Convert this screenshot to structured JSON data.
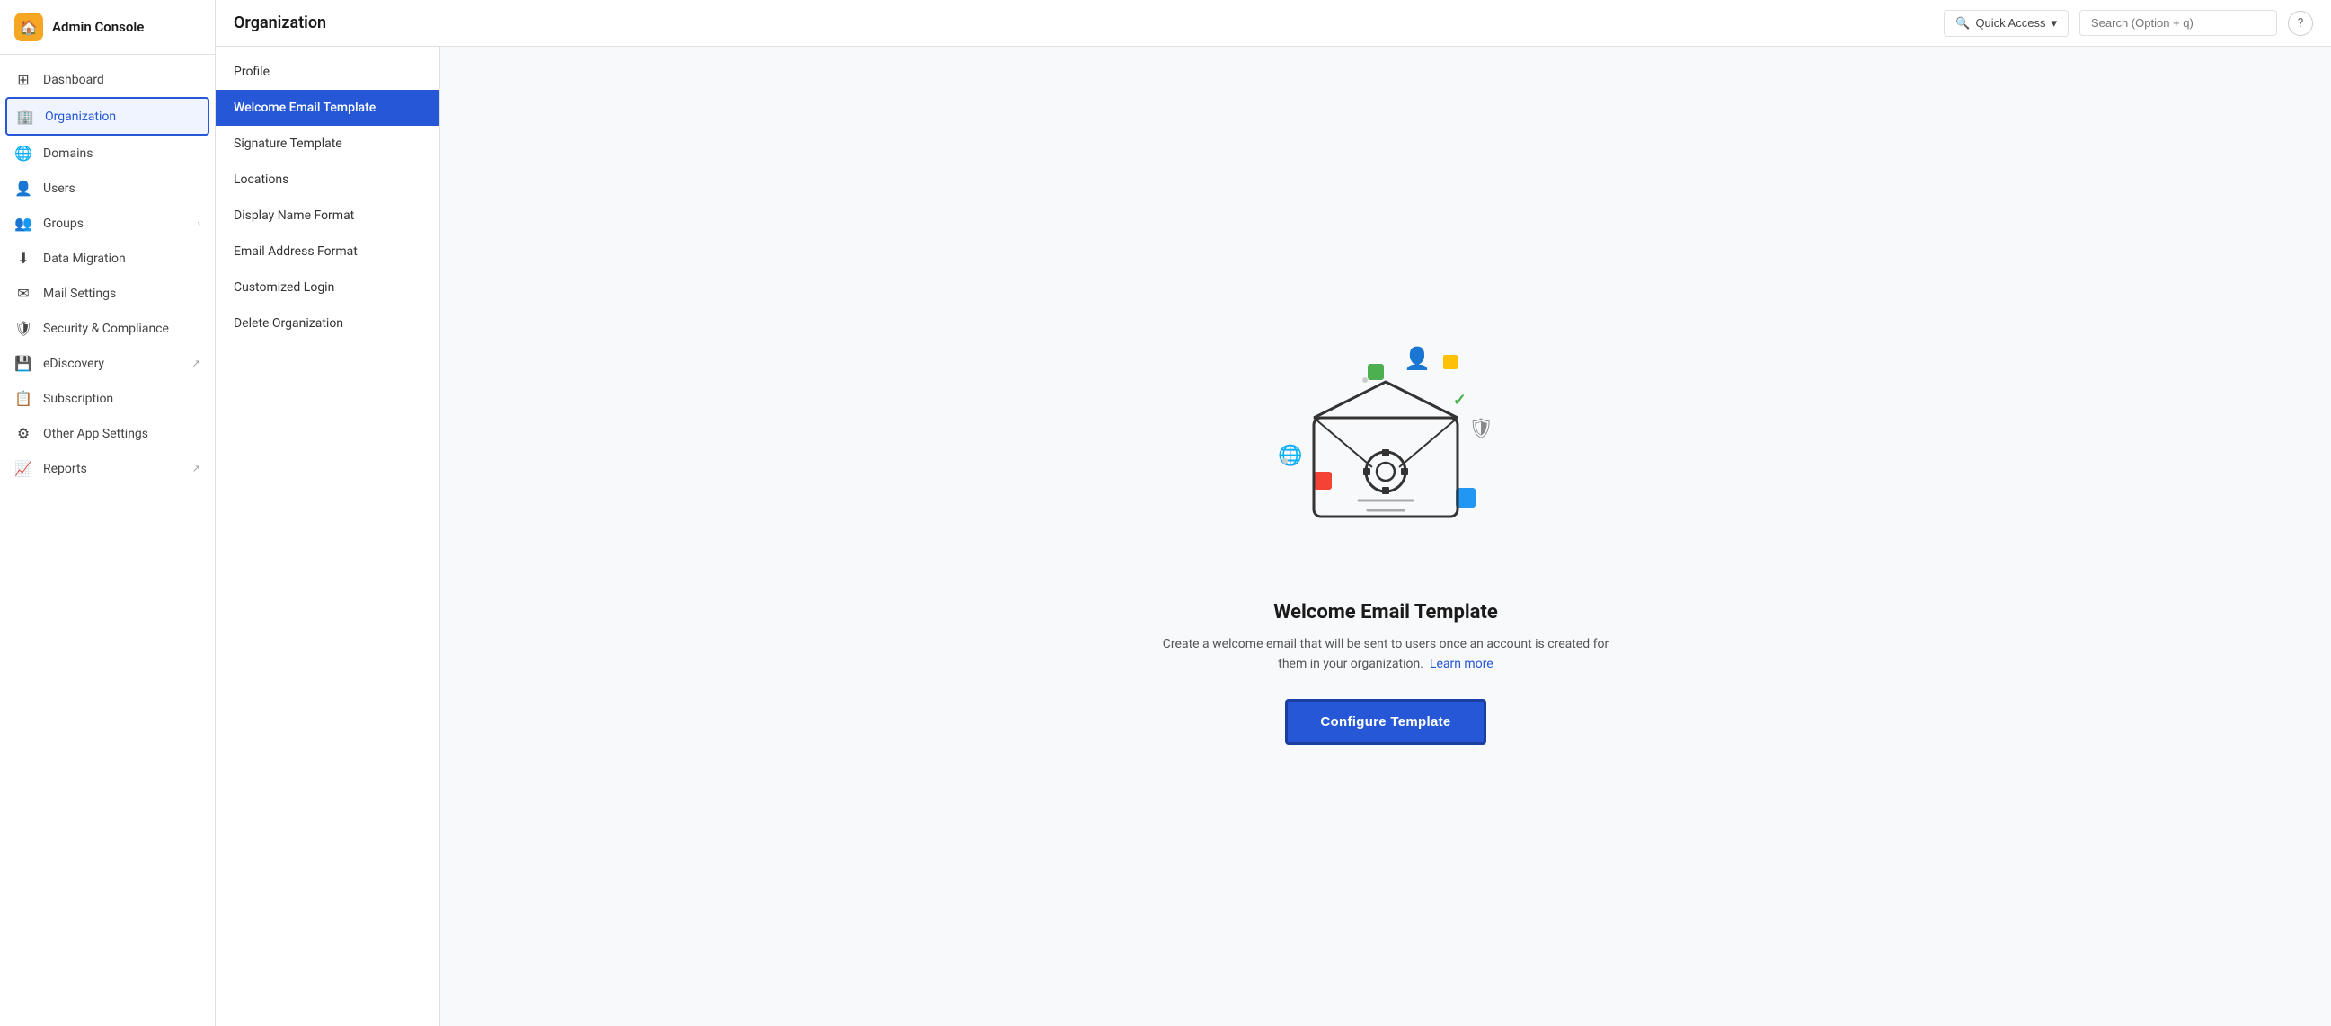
{
  "app": {
    "title": "Admin Console",
    "logo_icon": "🏠"
  },
  "topbar": {
    "title": "Organization",
    "quick_access_label": "Quick Access",
    "search_placeholder": "Search (Option + q)",
    "help_icon": "?"
  },
  "sidebar": {
    "items": [
      {
        "id": "dashboard",
        "label": "Dashboard",
        "icon": "⊞",
        "active": false
      },
      {
        "id": "organization",
        "label": "Organization",
        "icon": "🏢",
        "active": true
      },
      {
        "id": "domains",
        "label": "Domains",
        "icon": "🌐",
        "active": false
      },
      {
        "id": "users",
        "label": "Users",
        "icon": "👤",
        "active": false
      },
      {
        "id": "groups",
        "label": "Groups",
        "icon": "👥",
        "active": false,
        "has_chevron": true
      },
      {
        "id": "data-migration",
        "label": "Data Migration",
        "icon": "⬇",
        "active": false
      },
      {
        "id": "mail-settings",
        "label": "Mail Settings",
        "icon": "✉",
        "active": false
      },
      {
        "id": "security",
        "label": "Security & Compliance",
        "icon": "🛡",
        "active": false
      },
      {
        "id": "ediscovery",
        "label": "eDiscovery",
        "icon": "💾",
        "active": false,
        "has_ext": true
      },
      {
        "id": "subscription",
        "label": "Subscription",
        "icon": "📋",
        "active": false
      },
      {
        "id": "other-app",
        "label": "Other App Settings",
        "icon": "⚙",
        "active": false
      },
      {
        "id": "reports",
        "label": "Reports",
        "icon": "📈",
        "active": false,
        "has_ext": true
      }
    ]
  },
  "sub_nav": {
    "items": [
      {
        "id": "profile",
        "label": "Profile",
        "active": false
      },
      {
        "id": "welcome-email",
        "label": "Welcome Email Template",
        "active": true
      },
      {
        "id": "signature",
        "label": "Signature Template",
        "active": false
      },
      {
        "id": "locations",
        "label": "Locations",
        "active": false
      },
      {
        "id": "display-name",
        "label": "Display Name Format",
        "active": false
      },
      {
        "id": "email-address",
        "label": "Email Address Format",
        "active": false
      },
      {
        "id": "customized-login",
        "label": "Customized Login",
        "active": false
      },
      {
        "id": "delete-org",
        "label": "Delete Organization",
        "active": false
      }
    ]
  },
  "welcome_page": {
    "title": "Welcome Email Template",
    "description": "Create a welcome email that will be sent to users once an account is created for them in your organization.",
    "learn_more_label": "Learn more",
    "configure_btn_label": "Configure Template"
  },
  "decorations": {
    "green_square": "#4caf50",
    "yellow_square": "#ffc107",
    "red_square": "#f44336",
    "blue_square": "#2196f3"
  }
}
